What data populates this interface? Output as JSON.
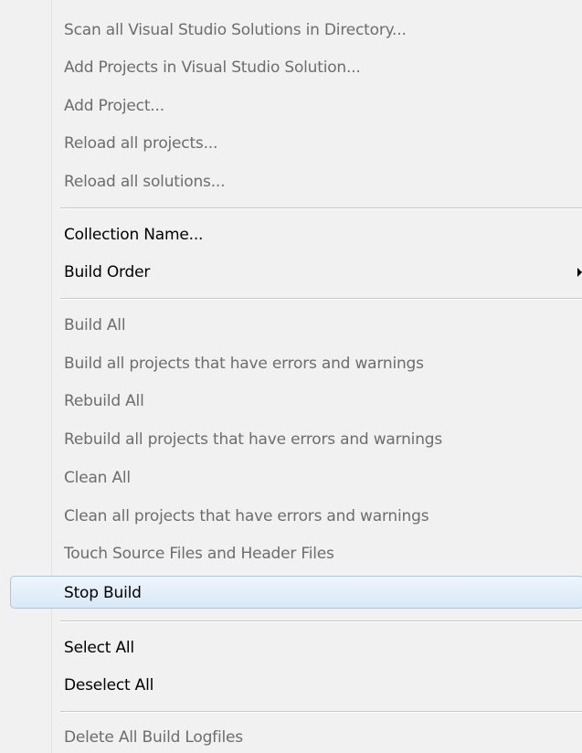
{
  "groups": {
    "project_items": [
      {
        "label": "Scan all Visual Studio Solutions in Directory...",
        "enabled": false
      },
      {
        "label": "Add Projects in Visual Studio Solution...",
        "enabled": false
      },
      {
        "label": "Add Project...",
        "enabled": false
      },
      {
        "label": "Reload all projects...",
        "enabled": false
      },
      {
        "label": "Reload all solutions...",
        "enabled": false
      }
    ],
    "collection_items": [
      {
        "label": "Collection Name...",
        "enabled": true
      },
      {
        "label": "Build Order",
        "enabled": true,
        "has_submenu": true
      }
    ],
    "build_items": [
      {
        "label": "Build All",
        "enabled": false
      },
      {
        "label": "Build all projects that have errors and warnings",
        "enabled": false
      },
      {
        "label": "Rebuild All",
        "enabled": false
      },
      {
        "label": "Rebuild all projects that have errors and warnings",
        "enabled": false
      },
      {
        "label": "Clean All",
        "enabled": false
      },
      {
        "label": "Clean all projects that have errors and warnings",
        "enabled": false
      },
      {
        "label": "Touch Source Files and Header Files",
        "enabled": false
      },
      {
        "label": "Stop Build",
        "enabled": true,
        "highlighted": true
      }
    ],
    "selection_items": [
      {
        "label": "Select All",
        "enabled": true
      },
      {
        "label": "Deselect All",
        "enabled": true
      }
    ],
    "log_items": [
      {
        "label": "Delete All Build Logfiles",
        "enabled": false
      }
    ]
  },
  "submenu_icon": "chevron-right-icon",
  "colors": {
    "menu_background": "#f1f1f1",
    "disabled_text": "#6d6d6d",
    "enabled_text": "#000000",
    "highlight_border": "#a9c6e6",
    "highlight_fill": "#d9e8f7"
  }
}
